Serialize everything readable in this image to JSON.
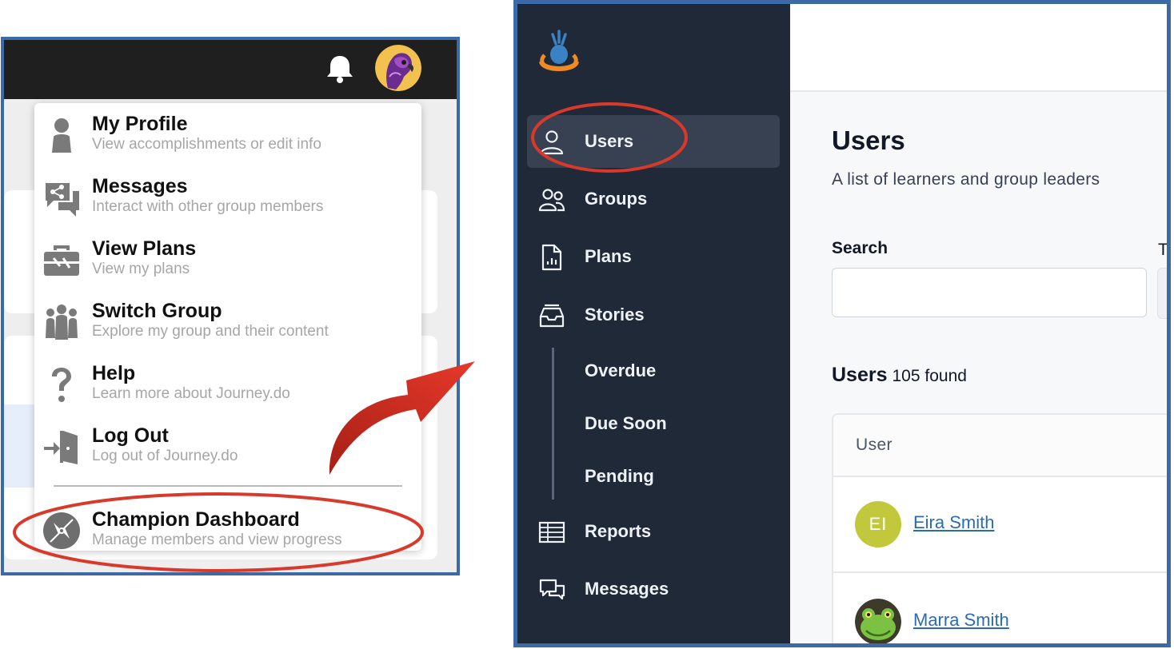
{
  "left_menu": {
    "items": [
      {
        "title": "My Profile",
        "subtitle": "View accomplishments or edit info",
        "icon": "person-icon"
      },
      {
        "title": "Messages",
        "subtitle": "Interact with other group members",
        "icon": "chat-share-icon"
      },
      {
        "title": "View Plans",
        "subtitle": "View my plans",
        "icon": "toolbox-icon"
      },
      {
        "title": "Switch Group",
        "subtitle": "Explore my group and their content",
        "icon": "group-icon"
      },
      {
        "title": "Help",
        "subtitle": "Learn more about Journey.do",
        "icon": "question-icon"
      },
      {
        "title": "Log Out",
        "subtitle": "Log out of Journey.do",
        "icon": "logout-icon"
      }
    ],
    "champion": {
      "title": "Champion Dashboard",
      "subtitle": "Manage members and view progress",
      "icon": "compass-icon"
    }
  },
  "sidebar": {
    "nav": [
      {
        "label": "Users",
        "icon": "user-icon",
        "active": true
      },
      {
        "label": "Groups",
        "icon": "users-icon",
        "active": false
      },
      {
        "label": "Plans",
        "icon": "document-chart-icon",
        "active": false
      },
      {
        "label": "Stories",
        "icon": "inbox-stack-icon",
        "active": false
      }
    ],
    "stories_sub": [
      "Overdue",
      "Due Soon",
      "Pending"
    ],
    "nav_bottom": [
      {
        "label": "Reports",
        "icon": "table-icon"
      },
      {
        "label": "Messages",
        "icon": "chat-bubbles-icon"
      }
    ]
  },
  "main": {
    "title": "Users",
    "subtitle": "A list of learners and group leaders",
    "search_label": "Search",
    "search_value": "",
    "second_label_partial": "T",
    "users_heading": "Users",
    "users_count": "105 found",
    "table": {
      "header": "User",
      "rows": [
        {
          "name": "Eira Smith",
          "initials": "EI"
        },
        {
          "name": "Marra Smith",
          "initials": ""
        }
      ]
    }
  },
  "colors": {
    "sidebar_bg": "#1f2937",
    "active_nav_bg": "#374151",
    "link": "#2b6cb0",
    "highlight_outline": "#d9392b",
    "frame_border": "#3c6aa6",
    "initials_avatar": "#c2c83b"
  }
}
